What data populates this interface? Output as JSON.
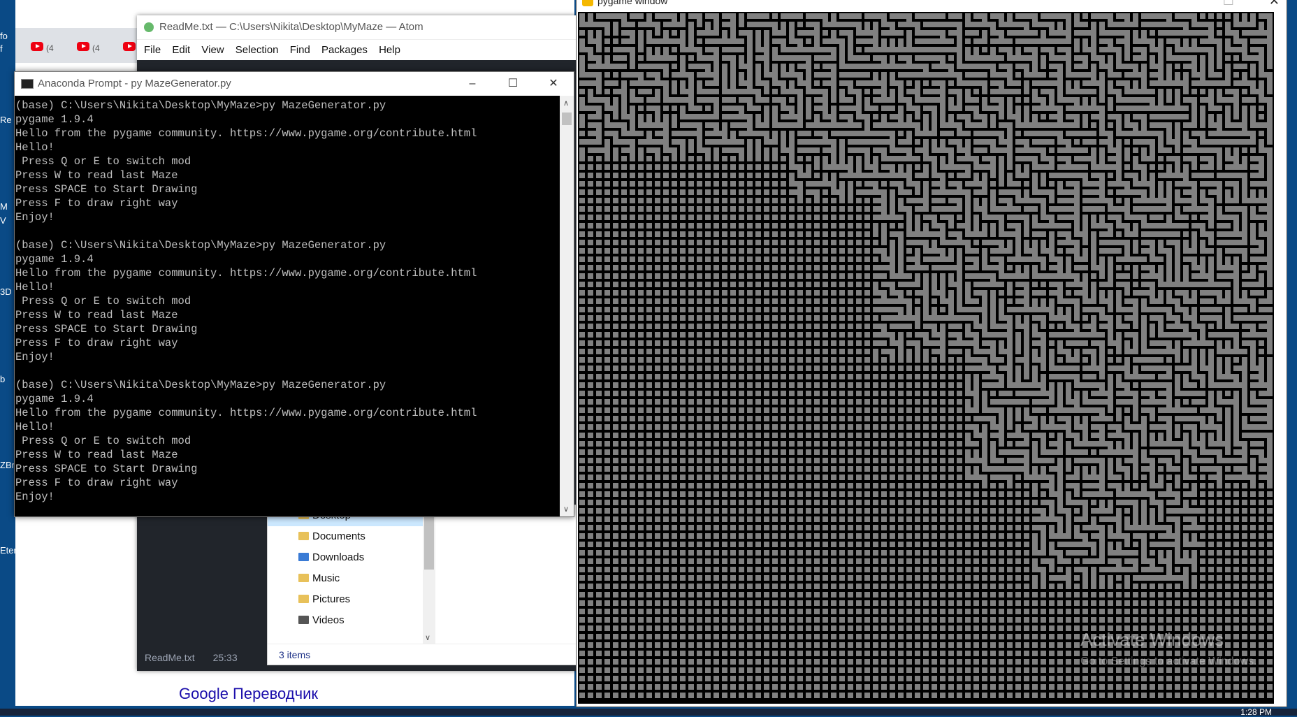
{
  "desktop": {
    "labels": [
      "fo",
      "f",
      "Re",
      "M",
      "V",
      "3D",
      "b",
      "ZBr",
      "Eter"
    ]
  },
  "browser": {
    "tabs": [
      "(4",
      "(4",
      ""
    ],
    "link": "Google Переводчик"
  },
  "atom": {
    "title": "ReadMe.txt — C:\\Users\\Nikita\\Desktop\\MyMaze — Atom",
    "menu": [
      "File",
      "Edit",
      "View",
      "Selection",
      "Find",
      "Packages",
      "Help"
    ],
    "status_file": "ReadMe.txt",
    "status_pos": "25:33"
  },
  "explorer": {
    "items": [
      "Desktop",
      "Documents",
      "Downloads",
      "Music",
      "Pictures",
      "Videos"
    ],
    "status": "3 items"
  },
  "prompt": {
    "title": "Anaconda Prompt - py  MazeGenerator.py",
    "console_blocks": [
      [
        "(base) C:\\Users\\Nikita\\Desktop\\MyMaze>py MazeGenerator.py",
        "pygame 1.9.4",
        "Hello from the pygame community. https://www.pygame.org/contribute.html",
        "Hello!",
        " Press Q or E to switch mod",
        "Press W to read last Maze",
        "Press SPACE to Start Drawing",
        "Press F to draw right way",
        "Enjoy!"
      ],
      [
        "(base) C:\\Users\\Nikita\\Desktop\\MyMaze>py MazeGenerator.py",
        "pygame 1.9.4",
        "Hello from the pygame community. https://www.pygame.org/contribute.html",
        "Hello!",
        " Press Q or E to switch mod",
        "Press W to read last Maze",
        "Press SPACE to Start Drawing",
        "Press F to draw right way",
        "Enjoy!"
      ],
      [
        "(base) C:\\Users\\Nikita\\Desktop\\MyMaze>py MazeGenerator.py",
        "pygame 1.9.4",
        "Hello from the pygame community. https://www.pygame.org/contribute.html",
        "Hello!",
        " Press Q or E to switch mod",
        "Press W to read last Maze",
        "Press SPACE to Start Drawing",
        "Press F to draw right way",
        "Enjoy!"
      ]
    ]
  },
  "pygame": {
    "title": "pygame window",
    "wall_color": "#000000",
    "cell_color": "#808080"
  },
  "watermark": {
    "line1": "Activate Windows",
    "line2": "Go to Settings to activate Windows."
  },
  "taskbar": {
    "clock": "1:28 PM"
  }
}
